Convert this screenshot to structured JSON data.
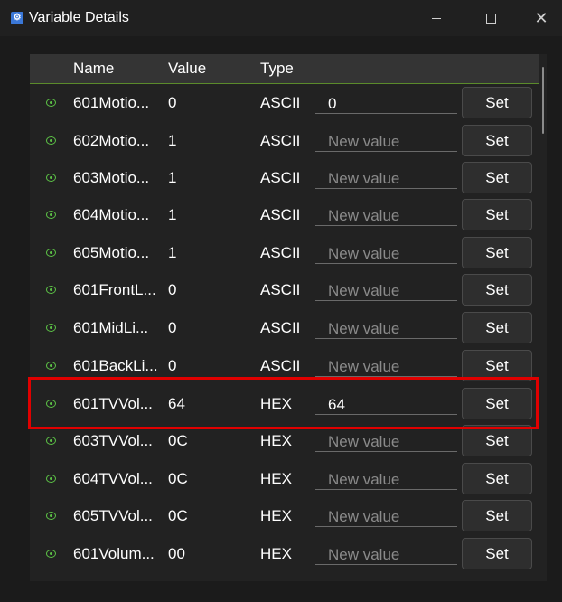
{
  "window": {
    "title": "Variable Details",
    "icon": "app-icon",
    "minimize_icon": "minimize-icon",
    "maximize_icon": "maximize-icon",
    "close_icon": "close-icon"
  },
  "table": {
    "columns": [
      "Name",
      "Value",
      "Type"
    ],
    "placeholder": "New value",
    "set_label": "Set",
    "rows": [
      {
        "name": "601Motio...",
        "value": "0",
        "type": "ASCII",
        "input": "0"
      },
      {
        "name": "602Motio...",
        "value": "1",
        "type": "ASCII",
        "input": ""
      },
      {
        "name": "603Motio...",
        "value": "1",
        "type": "ASCII",
        "input": ""
      },
      {
        "name": "604Motio...",
        "value": "1",
        "type": "ASCII",
        "input": ""
      },
      {
        "name": "605Motio...",
        "value": "1",
        "type": "ASCII",
        "input": ""
      },
      {
        "name": "601FrontL...",
        "value": "0",
        "type": "ASCII",
        "input": ""
      },
      {
        "name": "601MidLi...",
        "value": "0",
        "type": "ASCII",
        "input": ""
      },
      {
        "name": "601BackLi...",
        "value": "0",
        "type": "ASCII",
        "input": ""
      },
      {
        "name": "601TVVol...",
        "value": "64",
        "type": "HEX",
        "input": "64"
      },
      {
        "name": "603TVVol...",
        "value": "0C",
        "type": "HEX",
        "input": ""
      },
      {
        "name": "604TVVol...",
        "value": "0C",
        "type": "HEX",
        "input": ""
      },
      {
        "name": "605TVVol...",
        "value": "0C",
        "type": "HEX",
        "input": ""
      },
      {
        "name": "601Volum...",
        "value": "00",
        "type": "HEX",
        "input": ""
      }
    ]
  },
  "colors": {
    "background": "#1b1b1b",
    "header": "#343434",
    "accent": "#5bbf45",
    "highlight": "#e00000"
  }
}
